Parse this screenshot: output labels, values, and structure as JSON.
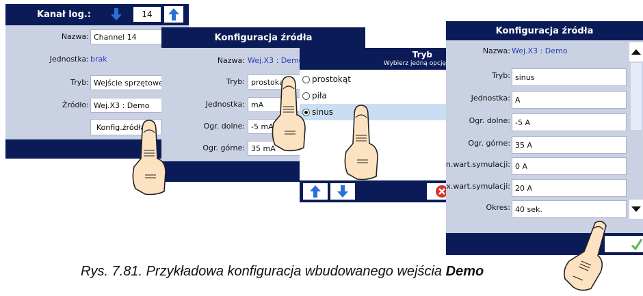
{
  "screen1": {
    "header_label": "Kanał log.:",
    "channel_number": "14",
    "fields": [
      {
        "label": "Nazwa:",
        "value": "Channel 14"
      },
      {
        "label": "Jednostka:",
        "value": "brak"
      },
      {
        "label": "Tryb:",
        "value": "Wejście sprzętowe"
      },
      {
        "label": "Źródło:",
        "value": "Wej.X3 : Demo"
      }
    ],
    "config_button": "Konfig.źródła"
  },
  "screen2": {
    "title": "Konfiguracja źródła",
    "fields": [
      {
        "label": "Nazwa:",
        "value": "Wej.X3 : Demo"
      },
      {
        "label": "Tryb:",
        "value": "prostokąt"
      },
      {
        "label": "Jednostka:",
        "value": "mA"
      },
      {
        "label": "Ogr. dolne:",
        "value": "-5 mA"
      },
      {
        "label": "Ogr. górne:",
        "value": "35 mA"
      }
    ]
  },
  "dialog": {
    "title": "Tryb",
    "subtitle": "Wybierz jedną opcję",
    "options": [
      "prostokąt",
      "piła",
      "sinus"
    ],
    "selected": "sinus"
  },
  "screen3": {
    "title": "Konfiguracja źródła",
    "fields": [
      {
        "label": "Nazwa:",
        "value": "Wej.X3 : Demo"
      },
      {
        "label": "Tryb:",
        "value": "sinus"
      },
      {
        "label": "Jednostka:",
        "value": "A"
      },
      {
        "label": "Ogr. dolne:",
        "value": "-5 A"
      },
      {
        "label": "Ogr. górne:",
        "value": "35 A"
      },
      {
        "label": "Min.wart.symulacji:",
        "value": "0 A"
      },
      {
        "label": "Max.wart.symulacji:",
        "value": "20 A"
      },
      {
        "label": "Okres:",
        "value": "40 sek."
      }
    ]
  },
  "caption": {
    "text": "Rys. 7.81. Przykładowa konfiguracja wbudowanego wejścia",
    "bold": "Demo"
  },
  "colors": {
    "header": "#0a1b57",
    "panel": "#c9d1e3",
    "accent_blue": "#2a6fd6",
    "link_text": "#2a3db8",
    "selected_row": "#c9def2",
    "cancel_red": "#d9342b",
    "ok_green": "#55b84a"
  }
}
